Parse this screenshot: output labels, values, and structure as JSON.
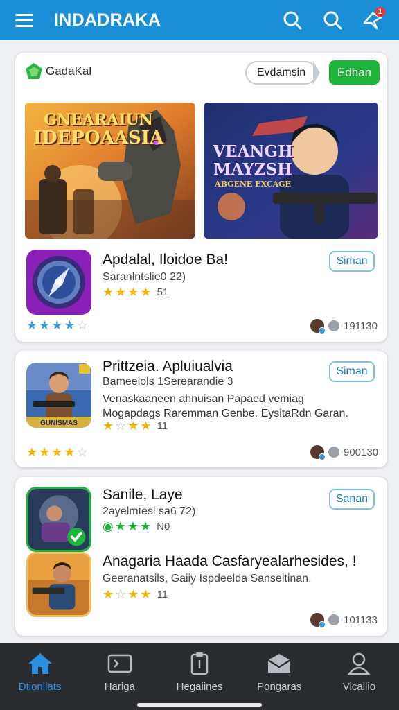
{
  "header": {
    "title": "INDADRAKA",
    "notification_count": "1"
  },
  "featured": {
    "brand": "GadaKal",
    "pill_text": "Evdamsin",
    "green_button": "Edhan",
    "banner1_text": [
      "GNEARAIUN",
      "IDEPOAASIA"
    ],
    "banner2_text": [
      "VEANGH",
      "MAYZSH",
      "ABGENE EXCAGE"
    ],
    "app": {
      "title": "Apdalal, Iloidoe Ba!",
      "subtitle": "Saranlntslie0 22)",
      "rating": "51",
      "button": "Siman",
      "meta": "191130"
    }
  },
  "list": [
    {
      "title": "Prittzeia. Apluiualvia",
      "subtitle": "Bameelols 1Serearandie 3",
      "description": "Venaskaaneen ahnuisan Papaed vemiag Mogapdags Raremman Genbe. EysitaRdn Garan.",
      "icon_caption": "GUNISMAS",
      "rating": "11",
      "button": "Siman",
      "meta": "900130"
    },
    {
      "title": "Sanile, Laye",
      "subtitle": "2ayelmtesl sa6 72)",
      "rating": "N0",
      "button": "Sanan"
    },
    {
      "title": "Anagaria Haada Casfaryealarhesides, !",
      "subtitle": "Geeranatsils, Gaiiy Ispdeelda Sanseltinan.",
      "rating": "11",
      "meta": "101133"
    }
  ],
  "nav": [
    {
      "label": "Dtionllats",
      "icon": "home-icon",
      "active": true
    },
    {
      "label": "Hariga",
      "icon": "terminal-icon"
    },
    {
      "label": "Hegaiines",
      "icon": "clipboard-icon"
    },
    {
      "label": "Pongaras",
      "icon": "mail-icon"
    },
    {
      "label": "Vicallio",
      "icon": "user-icon"
    }
  ],
  "colors": {
    "accent": "#1a8fd6",
    "green": "#1db43a",
    "nav_bg": "#2a2c30",
    "star_yellow": "#f5b400"
  }
}
